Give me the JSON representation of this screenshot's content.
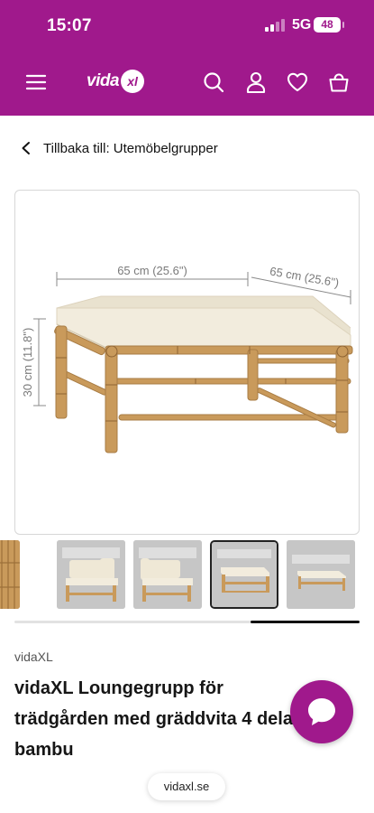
{
  "status_bar": {
    "time": "15:07",
    "network": "5G",
    "battery": "48"
  },
  "header": {
    "logo_text": "vida",
    "logo_badge": "xl",
    "icons": [
      "menu-icon",
      "search-icon",
      "user-icon",
      "heart-icon",
      "basket-icon"
    ]
  },
  "back_link": {
    "label": "Tillbaka till: Utemöbelgrupper"
  },
  "product_image": {
    "dim_width": "65 cm (25.6\")",
    "dim_depth": "65 cm (25.6\")",
    "dim_height": "30 cm (11.8\")"
  },
  "thumbnails": {
    "count_visible": 5,
    "selected_index": 3
  },
  "product": {
    "brand": "vidaXL",
    "title": "vidaXL Loungegrupp för trädgården med gräddvita 4 delar bambu"
  },
  "chat": {
    "icon": "chat-bubble-icon"
  },
  "browser": {
    "url": "vidaxl.se"
  },
  "colors": {
    "brand_purple": "#a0198c",
    "bamboo": "#c99a5b",
    "cushion": "#f2ecdd"
  }
}
